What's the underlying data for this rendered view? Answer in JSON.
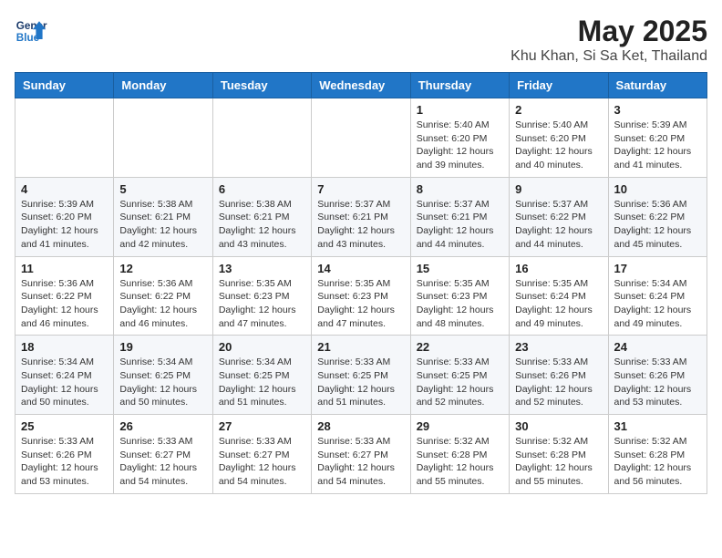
{
  "header": {
    "logo_line1": "General",
    "logo_line2": "Blue",
    "month": "May 2025",
    "location": "Khu Khan, Si Sa Ket, Thailand"
  },
  "weekdays": [
    "Sunday",
    "Monday",
    "Tuesday",
    "Wednesday",
    "Thursday",
    "Friday",
    "Saturday"
  ],
  "weeks": [
    [
      {
        "day": "",
        "info": ""
      },
      {
        "day": "",
        "info": ""
      },
      {
        "day": "",
        "info": ""
      },
      {
        "day": "",
        "info": ""
      },
      {
        "day": "1",
        "info": "Sunrise: 5:40 AM\nSunset: 6:20 PM\nDaylight: 12 hours\nand 39 minutes."
      },
      {
        "day": "2",
        "info": "Sunrise: 5:40 AM\nSunset: 6:20 PM\nDaylight: 12 hours\nand 40 minutes."
      },
      {
        "day": "3",
        "info": "Sunrise: 5:39 AM\nSunset: 6:20 PM\nDaylight: 12 hours\nand 41 minutes."
      }
    ],
    [
      {
        "day": "4",
        "info": "Sunrise: 5:39 AM\nSunset: 6:20 PM\nDaylight: 12 hours\nand 41 minutes."
      },
      {
        "day": "5",
        "info": "Sunrise: 5:38 AM\nSunset: 6:21 PM\nDaylight: 12 hours\nand 42 minutes."
      },
      {
        "day": "6",
        "info": "Sunrise: 5:38 AM\nSunset: 6:21 PM\nDaylight: 12 hours\nand 43 minutes."
      },
      {
        "day": "7",
        "info": "Sunrise: 5:37 AM\nSunset: 6:21 PM\nDaylight: 12 hours\nand 43 minutes."
      },
      {
        "day": "8",
        "info": "Sunrise: 5:37 AM\nSunset: 6:21 PM\nDaylight: 12 hours\nand 44 minutes."
      },
      {
        "day": "9",
        "info": "Sunrise: 5:37 AM\nSunset: 6:22 PM\nDaylight: 12 hours\nand 44 minutes."
      },
      {
        "day": "10",
        "info": "Sunrise: 5:36 AM\nSunset: 6:22 PM\nDaylight: 12 hours\nand 45 minutes."
      }
    ],
    [
      {
        "day": "11",
        "info": "Sunrise: 5:36 AM\nSunset: 6:22 PM\nDaylight: 12 hours\nand 46 minutes."
      },
      {
        "day": "12",
        "info": "Sunrise: 5:36 AM\nSunset: 6:22 PM\nDaylight: 12 hours\nand 46 minutes."
      },
      {
        "day": "13",
        "info": "Sunrise: 5:35 AM\nSunset: 6:23 PM\nDaylight: 12 hours\nand 47 minutes."
      },
      {
        "day": "14",
        "info": "Sunrise: 5:35 AM\nSunset: 6:23 PM\nDaylight: 12 hours\nand 47 minutes."
      },
      {
        "day": "15",
        "info": "Sunrise: 5:35 AM\nSunset: 6:23 PM\nDaylight: 12 hours\nand 48 minutes."
      },
      {
        "day": "16",
        "info": "Sunrise: 5:35 AM\nSunset: 6:24 PM\nDaylight: 12 hours\nand 49 minutes."
      },
      {
        "day": "17",
        "info": "Sunrise: 5:34 AM\nSunset: 6:24 PM\nDaylight: 12 hours\nand 49 minutes."
      }
    ],
    [
      {
        "day": "18",
        "info": "Sunrise: 5:34 AM\nSunset: 6:24 PM\nDaylight: 12 hours\nand 50 minutes."
      },
      {
        "day": "19",
        "info": "Sunrise: 5:34 AM\nSunset: 6:25 PM\nDaylight: 12 hours\nand 50 minutes."
      },
      {
        "day": "20",
        "info": "Sunrise: 5:34 AM\nSunset: 6:25 PM\nDaylight: 12 hours\nand 51 minutes."
      },
      {
        "day": "21",
        "info": "Sunrise: 5:33 AM\nSunset: 6:25 PM\nDaylight: 12 hours\nand 51 minutes."
      },
      {
        "day": "22",
        "info": "Sunrise: 5:33 AM\nSunset: 6:25 PM\nDaylight: 12 hours\nand 52 minutes."
      },
      {
        "day": "23",
        "info": "Sunrise: 5:33 AM\nSunset: 6:26 PM\nDaylight: 12 hours\nand 52 minutes."
      },
      {
        "day": "24",
        "info": "Sunrise: 5:33 AM\nSunset: 6:26 PM\nDaylight: 12 hours\nand 53 minutes."
      }
    ],
    [
      {
        "day": "25",
        "info": "Sunrise: 5:33 AM\nSunset: 6:26 PM\nDaylight: 12 hours\nand 53 minutes."
      },
      {
        "day": "26",
        "info": "Sunrise: 5:33 AM\nSunset: 6:27 PM\nDaylight: 12 hours\nand 54 minutes."
      },
      {
        "day": "27",
        "info": "Sunrise: 5:33 AM\nSunset: 6:27 PM\nDaylight: 12 hours\nand 54 minutes."
      },
      {
        "day": "28",
        "info": "Sunrise: 5:33 AM\nSunset: 6:27 PM\nDaylight: 12 hours\nand 54 minutes."
      },
      {
        "day": "29",
        "info": "Sunrise: 5:32 AM\nSunset: 6:28 PM\nDaylight: 12 hours\nand 55 minutes."
      },
      {
        "day": "30",
        "info": "Sunrise: 5:32 AM\nSunset: 6:28 PM\nDaylight: 12 hours\nand 55 minutes."
      },
      {
        "day": "31",
        "info": "Sunrise: 5:32 AM\nSunset: 6:28 PM\nDaylight: 12 hours\nand 56 minutes."
      }
    ]
  ]
}
